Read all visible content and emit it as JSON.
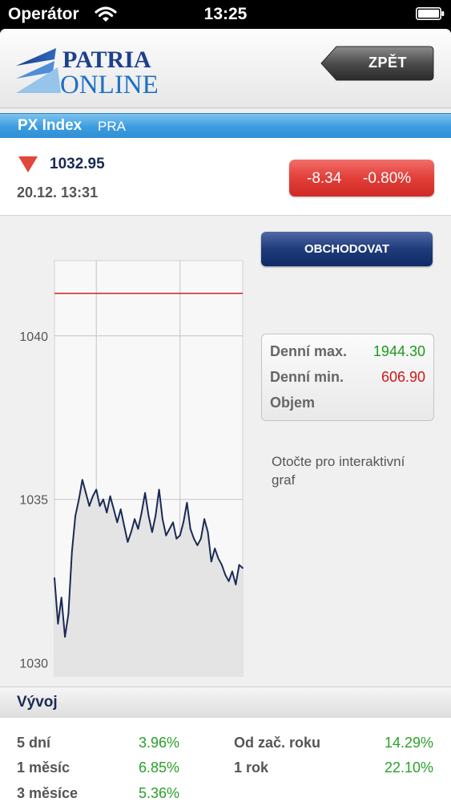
{
  "status_bar": {
    "carrier": "Operátor",
    "time": "13:25"
  },
  "header": {
    "logo_line1": "PATRIA",
    "logo_line2": "ONLINE",
    "back_label": "ZPĚT"
  },
  "instrument": {
    "name": "PX Index",
    "exchange": "PRA"
  },
  "quote": {
    "price": "1032.95",
    "datetime": "20.12. 13:31",
    "change_abs": "-8.34",
    "change_pct": "-0.80%",
    "direction": "down"
  },
  "trade_button_label": "OBCHODOVAT",
  "stats": [
    {
      "label": "Denní max.",
      "value": "1944.30",
      "color": "#1f9a1f"
    },
    {
      "label": "Denní min.",
      "value": "606.90",
      "color": "#d01818"
    },
    {
      "label": "Objem",
      "value": ""
    }
  ],
  "rotate_hint": "Otočte pro interaktivní graf",
  "chart_data": {
    "type": "area",
    "ylim": [
      1029.6,
      1042.3
    ],
    "yticks": [
      1030,
      1035,
      1040
    ],
    "xlim": [
      "09:00",
      "13:30"
    ],
    "xticks": [
      "10:00",
      "12:00"
    ],
    "previous_close": 1041.3,
    "x": [
      "09:00",
      "09:05",
      "09:10",
      "09:15",
      "09:20",
      "09:25",
      "09:30",
      "09:35",
      "09:40",
      "09:45",
      "09:50",
      "09:55",
      "10:00",
      "10:05",
      "10:10",
      "10:15",
      "10:20",
      "10:25",
      "10:30",
      "10:35",
      "10:40",
      "10:45",
      "10:50",
      "10:55",
      "11:00",
      "11:05",
      "11:10",
      "11:15",
      "11:20",
      "11:25",
      "11:30",
      "11:35",
      "11:40",
      "11:45",
      "11:50",
      "11:55",
      "12:00",
      "12:05",
      "12:10",
      "12:15",
      "12:20",
      "12:25",
      "12:30",
      "12:35",
      "12:40",
      "12:45",
      "12:50",
      "12:55",
      "13:00",
      "13:05",
      "13:10",
      "13:15",
      "13:20",
      "13:25",
      "13:30"
    ],
    "values": [
      1032.6,
      1031.2,
      1032.0,
      1030.8,
      1031.5,
      1033.4,
      1034.5,
      1035.0,
      1035.6,
      1035.2,
      1034.8,
      1035.1,
      1035.3,
      1034.8,
      1035.0,
      1034.6,
      1035.1,
      1034.7,
      1034.3,
      1034.7,
      1034.2,
      1033.7,
      1034.0,
      1034.4,
      1034.1,
      1034.6,
      1035.2,
      1034.5,
      1034.0,
      1034.5,
      1035.3,
      1034.4,
      1033.9,
      1034.1,
      1034.3,
      1033.8,
      1033.9,
      1034.3,
      1034.9,
      1034.1,
      1033.8,
      1033.6,
      1033.8,
      1034.4,
      1034.0,
      1033.1,
      1033.5,
      1033.2,
      1033.0,
      1032.7,
      1032.5,
      1032.8,
      1032.4,
      1033.0,
      1032.9
    ],
    "line_color": "#1a2a55",
    "reference_color": "#cc2222"
  },
  "performance": {
    "title": "Vývoj",
    "items": [
      {
        "label": "5 dní",
        "value": "3.96%"
      },
      {
        "label": "1 měsíc",
        "value": "6.85%"
      },
      {
        "label": "3 měsíce",
        "value": "5.36%"
      },
      {
        "label": "Od zač. roku",
        "value": "14.29%"
      },
      {
        "label": "1 rok",
        "value": "22.10%"
      }
    ]
  }
}
